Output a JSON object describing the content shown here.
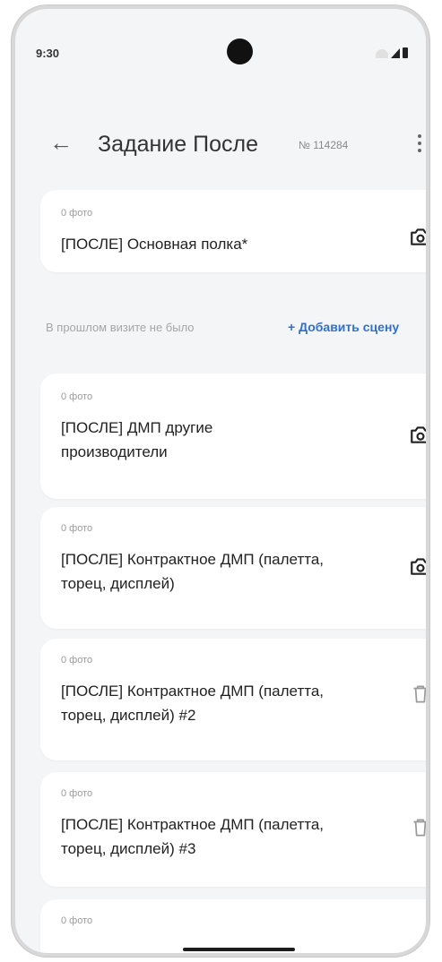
{
  "status_bar": {
    "time": "9:30"
  },
  "app_bar": {
    "title": "Задание После",
    "task_number": "№ 114284"
  },
  "scene_row": {
    "note": "В прошлом визите не было",
    "add_scene": "+ Добавить сцену"
  },
  "cards": [
    {
      "photo_count": "0 фото",
      "title": "[ПОСЛЕ] Основная полка*",
      "action_icon": "camera-icon"
    },
    {
      "photo_count": "0 фото",
      "title": "[ПОСЛЕ] ДМП другие производители",
      "action_icon": "camera-icon"
    },
    {
      "photo_count": "0 фото",
      "title": "[ПОСЛЕ] Контрактное ДМП (палетта, торец, дисплей)",
      "action_icon": "camera-icon"
    },
    {
      "photo_count": "0 фото",
      "title": "[ПОСЛЕ] Контрактное ДМП (палетта, торец, дисплей) #2",
      "action_icon": "trash-icon"
    },
    {
      "photo_count": "0 фото",
      "title": "[ПОСЛЕ] Контрактное ДМП (палетта, торец, дисплей) #3",
      "action_icon": "trash-icon"
    },
    {
      "photo_count": "0 фото",
      "title": "",
      "action_icon": ""
    }
  ],
  "colors": {
    "accent": "#2f6fd6",
    "background": "#f4f5f7",
    "card": "#ffffff"
  }
}
